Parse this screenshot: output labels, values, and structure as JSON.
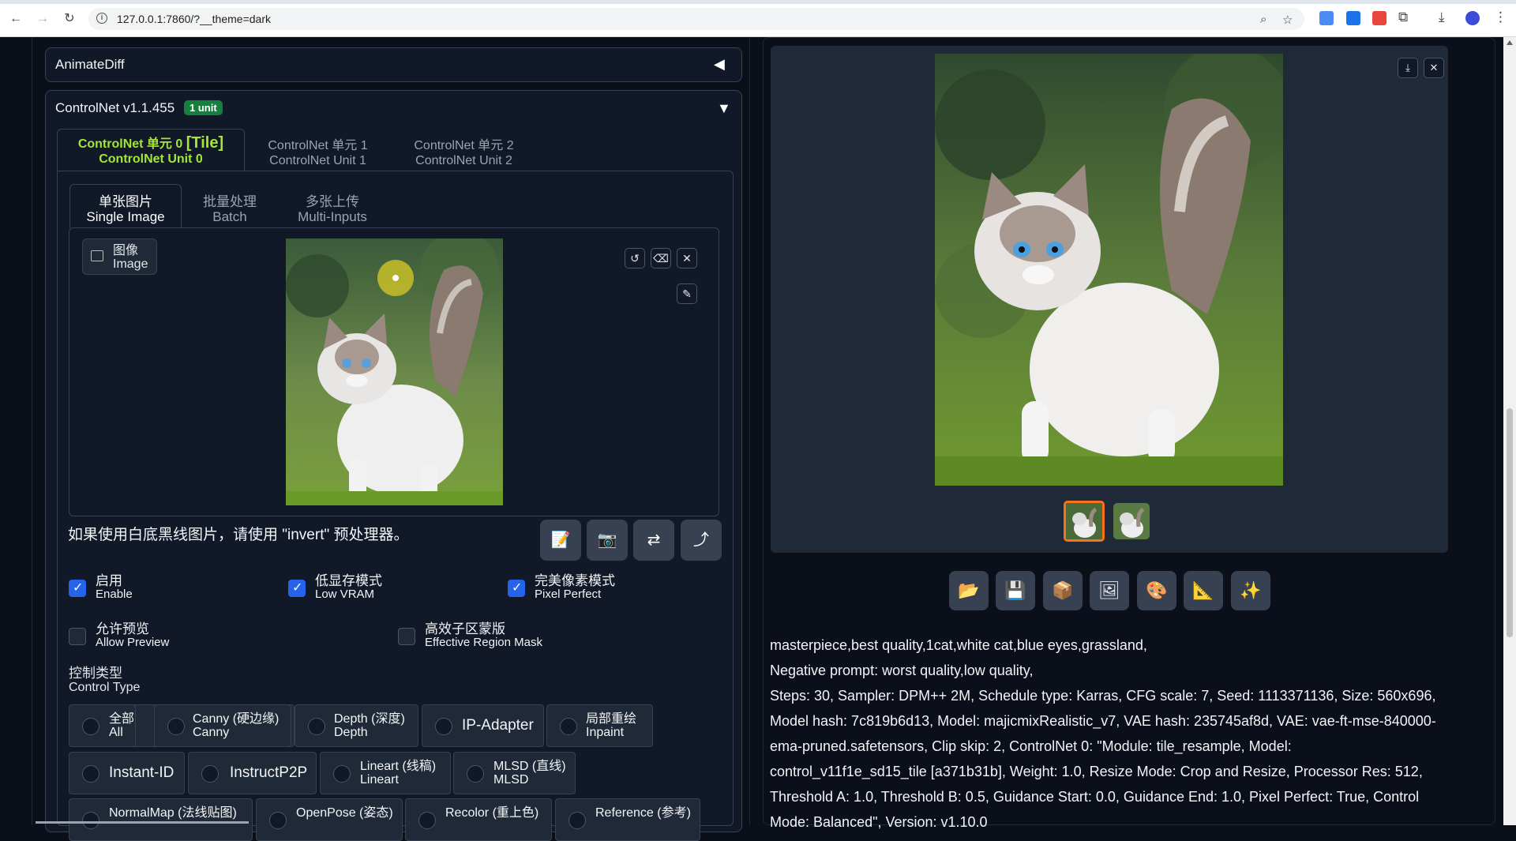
{
  "browser": {
    "url": "127.0.0.1:7860/?__theme=dark"
  },
  "animatediff": {
    "title": "AnimateDiff",
    "toggle": "◀"
  },
  "controlnet": {
    "title": "ControlNet v1.1.455",
    "badge": "1 unit",
    "toggle": "▼",
    "units": [
      {
        "zh": "ControlNet 单元 0",
        "tag": "[Tile]",
        "en": "ControlNet Unit 0"
      },
      {
        "zh": "ControlNet 单元 1",
        "en": "ControlNet Unit 1"
      },
      {
        "zh": "ControlNet 单元 2",
        "en": "ControlNet Unit 2"
      }
    ],
    "input_tabs": [
      {
        "zh": "单张图片",
        "en": "Single Image"
      },
      {
        "zh": "批量处理",
        "en": "Batch"
      },
      {
        "zh": "多张上传",
        "en": "Multi-Inputs"
      }
    ],
    "image_label": {
      "zh": "图像",
      "en": "Image"
    },
    "hint": "如果使用白底黑线图片，请使用 \"invert\" 预处理器。",
    "checkboxes": [
      {
        "zh": "启用",
        "en": "Enable",
        "checked": true
      },
      {
        "zh": "低显存模式",
        "en": "Low VRAM",
        "checked": true
      },
      {
        "zh": "完美像素模式",
        "en": "Pixel Perfect",
        "checked": true
      },
      {
        "zh": "允许预览",
        "en": "Allow Preview",
        "checked": false
      },
      {
        "zh": "高效子区蒙版",
        "en": "Effective Region Mask",
        "checked": false
      }
    ],
    "control_type_label": {
      "zh": "控制类型",
      "en": "Control Type"
    },
    "control_types_row1": [
      {
        "zh": "全部",
        "en": "All"
      },
      {
        "zh": "Canny (硬边缘)",
        "en": "Canny"
      },
      {
        "zh": "Depth (深度)",
        "en": "Depth"
      },
      {
        "single": "IP-Adapter"
      },
      {
        "zh": "局部重绘",
        "en": "Inpaint"
      }
    ],
    "control_types_row2": [
      {
        "single": "Instant-ID"
      },
      {
        "single": "InstructP2P"
      },
      {
        "zh": "Lineart (线稿)",
        "en": "Lineart"
      },
      {
        "zh": "MLSD (直线)",
        "en": "MLSD"
      }
    ],
    "control_types_row3": [
      {
        "zh": "NormalMap (法线贴图)"
      },
      {
        "zh": "OpenPose (姿态)"
      },
      {
        "zh": "Recolor (重上色)"
      },
      {
        "zh": "Reference (参考)"
      }
    ]
  },
  "output": {
    "info_lines": [
      "masterpiece,best quality,1cat,white cat,blue eyes,grassland,",
      "Negative prompt: worst quality,low quality,",
      "Steps: 30, Sampler: DPM++ 2M, Schedule type: Karras, CFG scale: 7, Seed: 1113371136, Size: 560x696,",
      "Model hash: 7c819b6d13, Model: majicmixRealistic_v7, VAE hash: 235745af8d, VAE: vae-ft-mse-840000-",
      "ema-pruned.safetensors, Clip skip: 2, ControlNet 0: \"Module: tile_resample, Model:",
      "control_v11f1e_sd15_tile [a371b31b], Weight: 1.0, Resize Mode: Crop and Resize, Processor Res: 512,",
      "Threshold A: 1.0, Threshold B: 0.5, Guidance Start: 0.0, Guidance End: 1.0, Pixel Perfect: True, Control",
      "Mode: Balanced\", Version: v1.10.0"
    ],
    "tools": [
      "folder-icon",
      "save-icon",
      "zip-icon",
      "image-icon",
      "palette-icon",
      "ruler-icon",
      "sparkle-icon"
    ]
  }
}
